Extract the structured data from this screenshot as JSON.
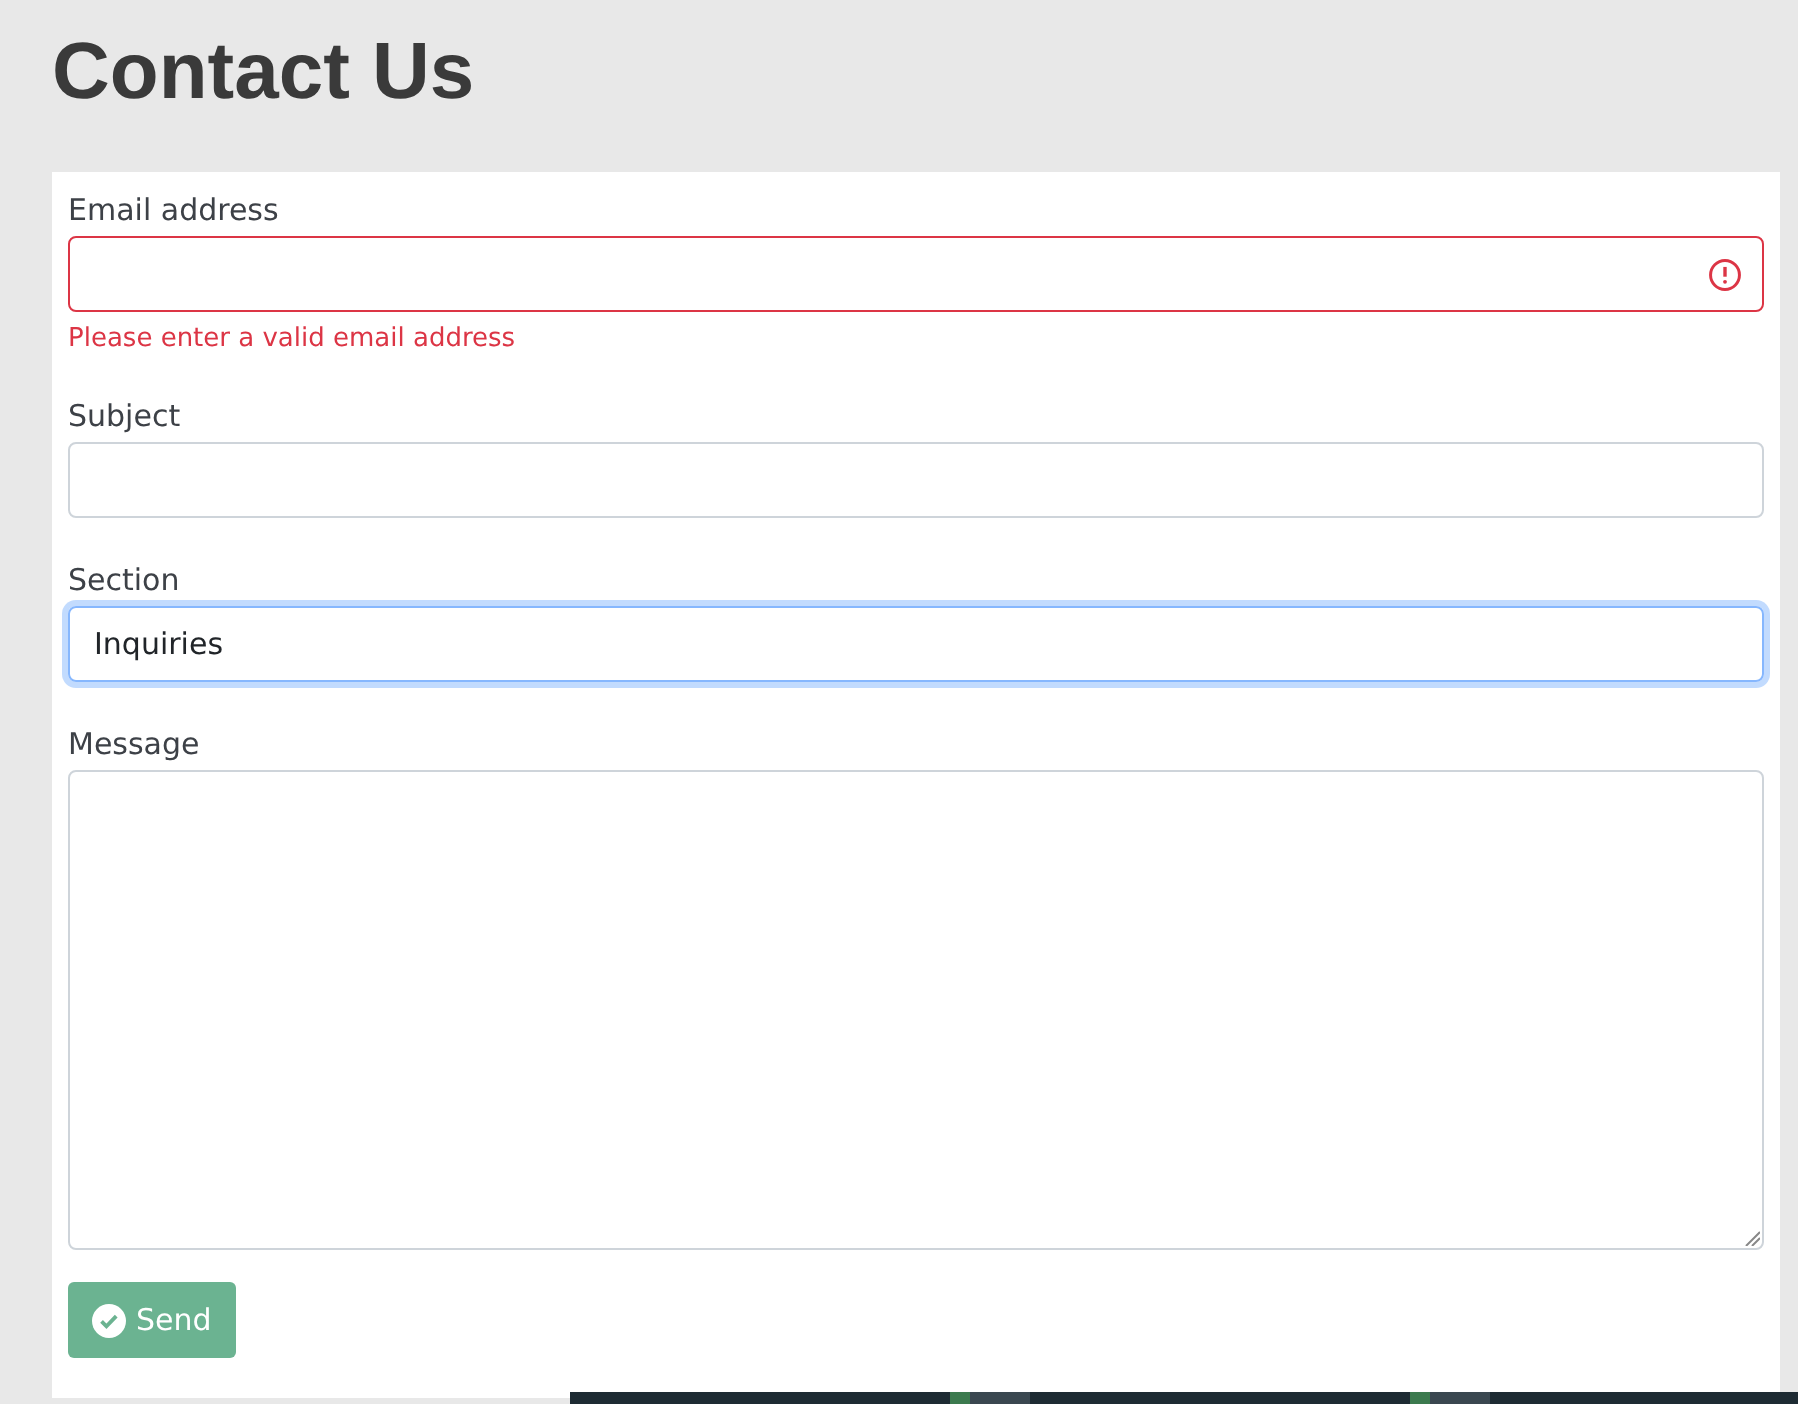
{
  "page": {
    "title": "Contact Us"
  },
  "fields": [
    {
      "kind": "input",
      "label": "Email address",
      "invalid": true,
      "focused": false,
      "error": "Please enter a valid email address"
    },
    {
      "kind": "input",
      "label": "Subject",
      "invalid": false,
      "focused": false
    },
    {
      "kind": "input",
      "label": "Section",
      "value": "Inquiries",
      "invalid": false,
      "focused": true
    },
    {
      "kind": "textarea",
      "label": "Message",
      "invalid": false,
      "focused": false
    }
  ],
  "send_button": {
    "label": "Send"
  }
}
